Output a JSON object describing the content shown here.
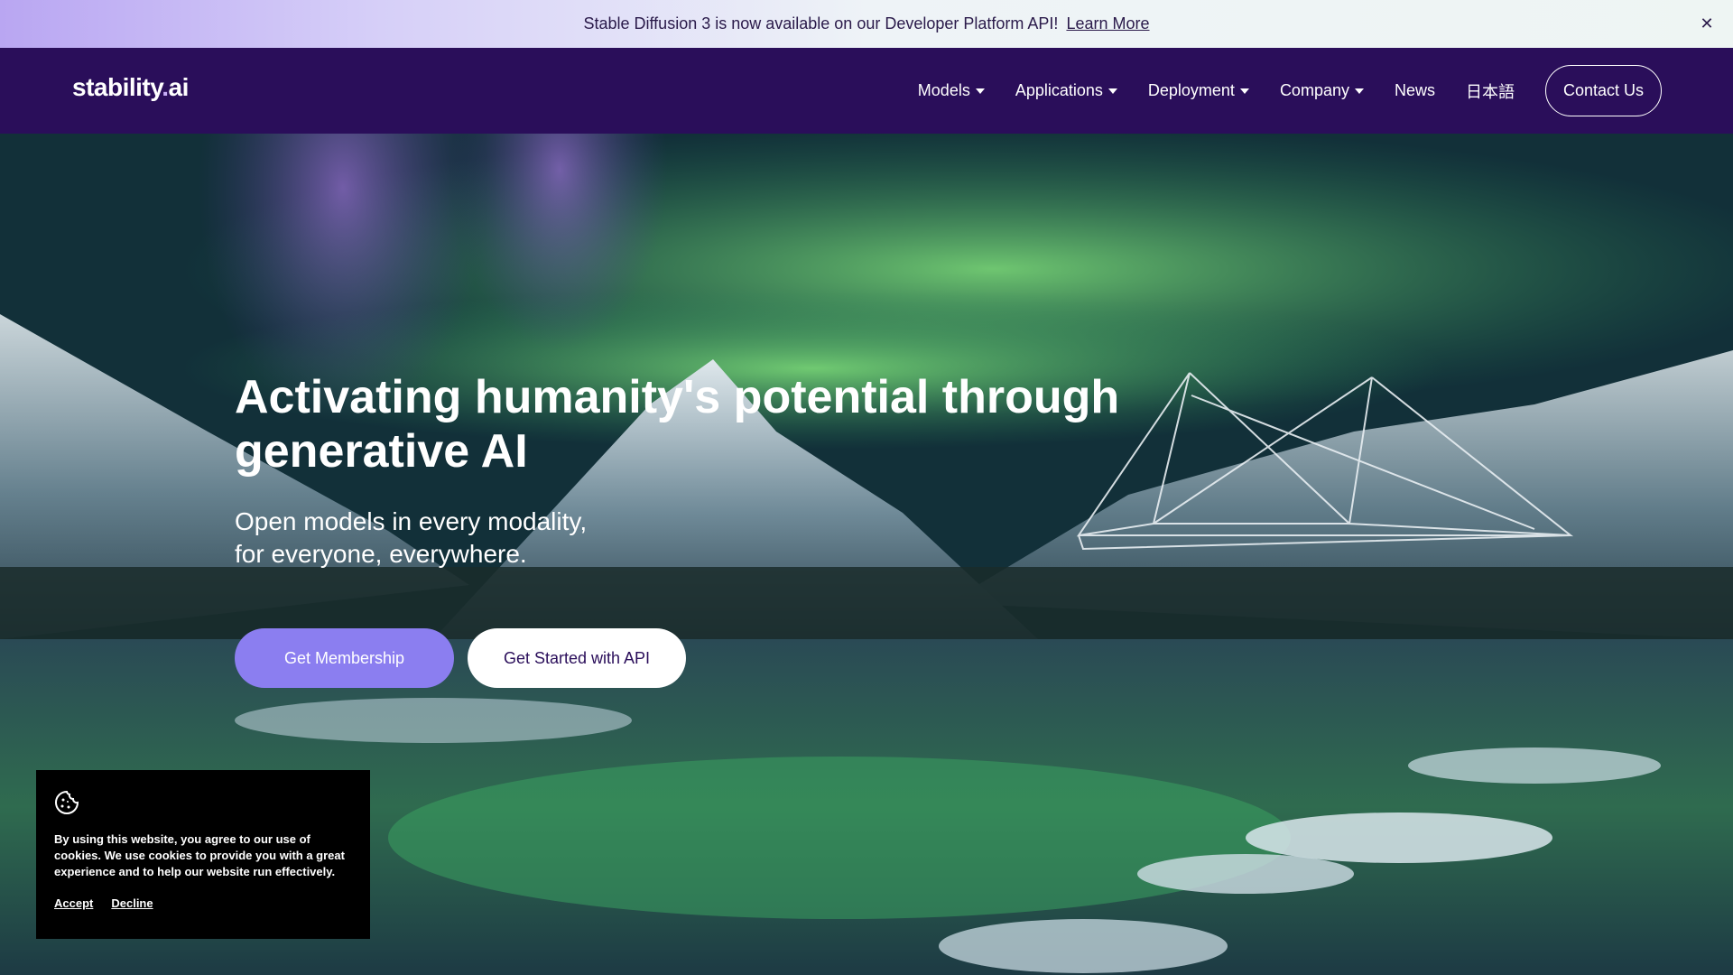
{
  "announcement": {
    "text": "Stable Diffusion 3 is now available on our Developer Platform API!",
    "link_label": "Learn More",
    "close_icon": "close-icon"
  },
  "nav": {
    "logo_main": "stability",
    "logo_dot": ".",
    "logo_end": "ai",
    "items": [
      {
        "label": "Models",
        "dropdown": true
      },
      {
        "label": "Applications",
        "dropdown": true
      },
      {
        "label": "Deployment",
        "dropdown": true
      },
      {
        "label": "Company",
        "dropdown": true
      },
      {
        "label": "News",
        "dropdown": false
      },
      {
        "label": "日本語",
        "dropdown": false
      }
    ],
    "contact_label": "Contact Us"
  },
  "hero": {
    "headline": "Activating humanity's potential through generative AI",
    "subhead_line1": "Open models in every modality,",
    "subhead_line2": "for everyone, everywhere.",
    "primary_button": "Get Membership",
    "secondary_button": "Get Started with API"
  },
  "cookie": {
    "icon": "cookie-icon",
    "text": "By using this website, you agree to our use of cookies. We use cookies to provide you with a great experience and to help our website run effectively.",
    "accept_label": "Accept",
    "decline_label": "Decline"
  },
  "colors": {
    "nav_bg": "#2a0e5a",
    "primary_button": "#8b7ef0",
    "announcement_text": "#2a1a4a"
  }
}
